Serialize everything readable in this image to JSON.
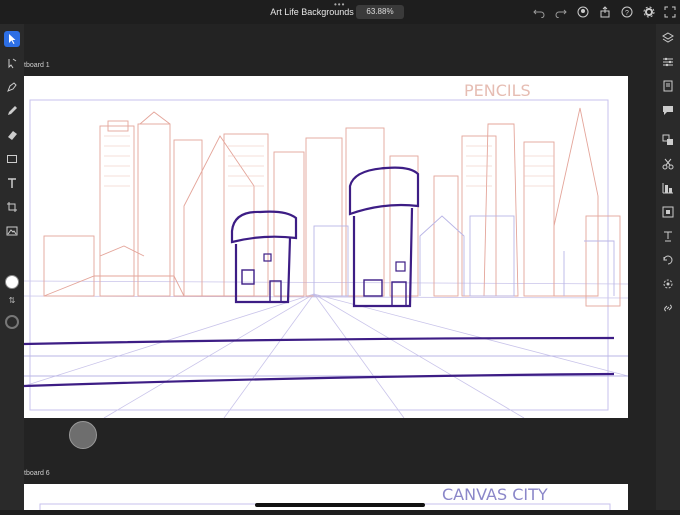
{
  "header": {
    "title": "Art Life Backgrounds",
    "zoom": "63.88%",
    "more_icon": "more-dots-icon"
  },
  "artboards": [
    {
      "label": "tboard 1",
      "sketch_text": "PENCILS"
    },
    {
      "label": "tboard 6",
      "sketch_text": "CANVAS CITY"
    }
  ],
  "toolbar_left": [
    "select-tool",
    "direct-select-tool",
    "pen-tool",
    "pencil-tool",
    "eraser-tool",
    "shape-tool",
    "type-tool",
    "crop-tool",
    "image-tool"
  ],
  "toolbar_right": [
    "layers-icon",
    "properties-icon",
    "libraries-icon",
    "comments-icon",
    "arrange-icon",
    "cut-icon",
    "align-icon",
    "transform-icon",
    "type-icon",
    "repeat-icon",
    "settings-icon",
    "link-icon"
  ],
  "colors": {
    "accent": "#2d6fe5",
    "sketch_red": "#e4a59a",
    "sketch_blue": "#b9b5e6",
    "ink": "#3d1d85"
  }
}
